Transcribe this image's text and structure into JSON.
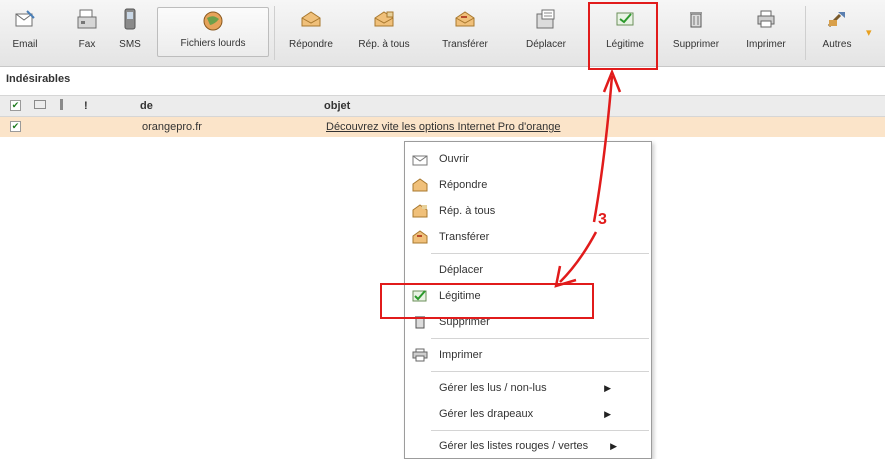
{
  "toolbar": {
    "email": "Email",
    "fax": "Fax",
    "sms": "SMS",
    "fichiers": "Fichiers lourds",
    "repondre": "Répondre",
    "rep_tous": "Rép. à tous",
    "transferer": "Transférer",
    "deplacer": "Déplacer",
    "legitime": "Légitime",
    "supprimer": "Supprimer",
    "imprimer": "Imprimer",
    "autres": "Autres"
  },
  "folder": {
    "title": "Indésirables"
  },
  "columns": {
    "flag": "!",
    "from": "de",
    "subject": "objet"
  },
  "message": {
    "from": "orangepro.fr",
    "subject": "Découvrez vite les options Internet Pro d'orange"
  },
  "context_menu": {
    "items": {
      "ouvrir": "Ouvrir",
      "repondre": "Répondre",
      "rep_tous": "Rép. à tous",
      "transferer": "Transférer",
      "deplacer": "Déplacer",
      "legitime": "Légitime",
      "supprimer": "Supprimer",
      "imprimer": "Imprimer",
      "gerer_lus": "Gérer les lus / non-lus",
      "gerer_drapeaux": "Gérer les drapeaux",
      "gerer_listes": "Gérer les listes rouges / vertes"
    }
  },
  "annotation": {
    "step": "3"
  },
  "colors": {
    "annotation": "#e11b1b",
    "selected_row": "#fbe4c9"
  }
}
